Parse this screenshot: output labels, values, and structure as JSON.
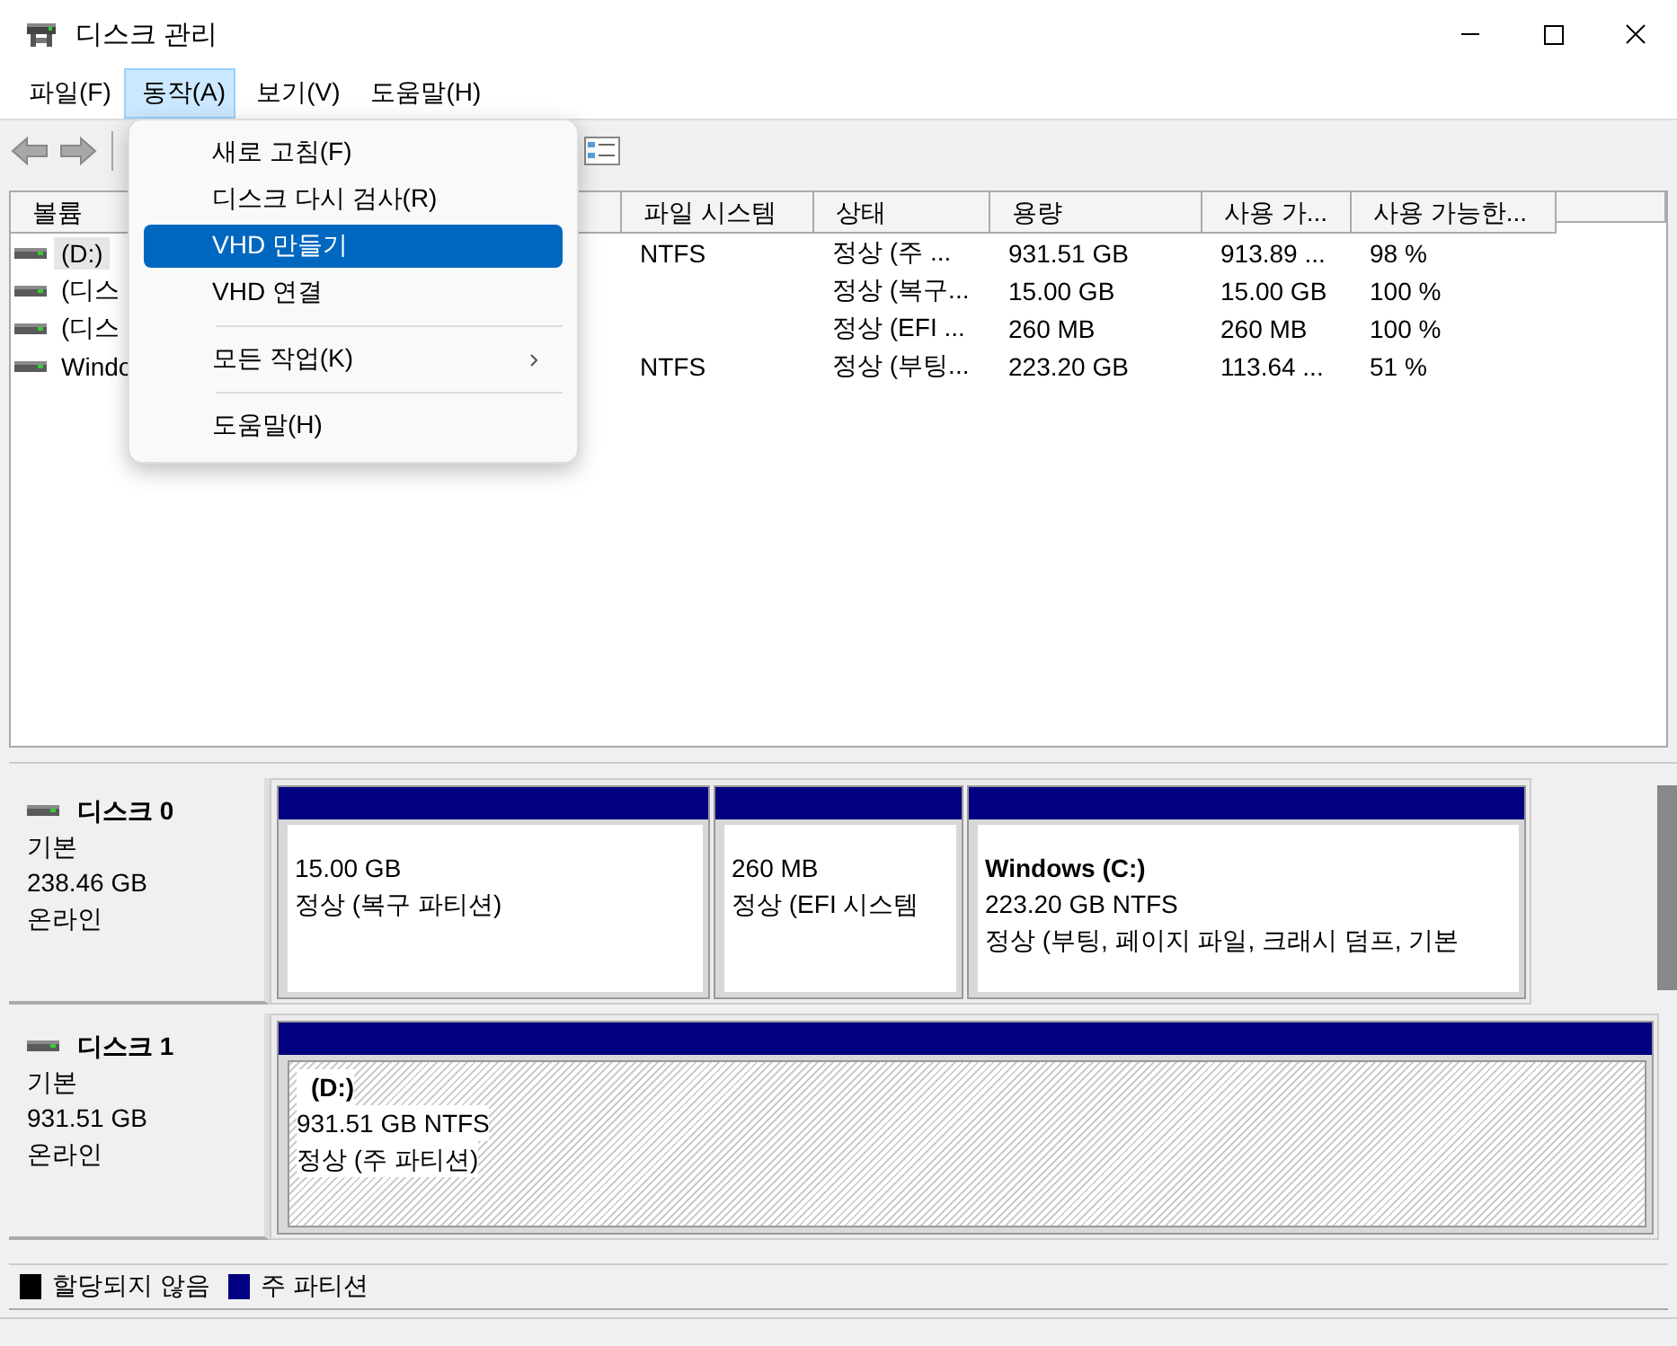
{
  "window": {
    "title": "디스크 관리"
  },
  "menubar": [
    {
      "label": "파일(F)",
      "selected": false
    },
    {
      "label": "동작(A)",
      "selected": true
    },
    {
      "label": "보기(V)",
      "selected": false
    },
    {
      "label": "도움말(H)",
      "selected": false
    }
  ],
  "action_menu": {
    "groups": [
      [
        {
          "label": "새로 고침(F)",
          "selected": false,
          "submenu": false
        },
        {
          "label": "디스크 다시 검사(R)",
          "selected": false,
          "submenu": false
        },
        {
          "label": "VHD 만들기",
          "selected": true,
          "submenu": false
        },
        {
          "label": "VHD 연결",
          "selected": false,
          "submenu": false
        }
      ],
      [
        {
          "label": "모든 작업(K)",
          "selected": false,
          "submenu": true
        }
      ],
      [
        {
          "label": "도움말(H)",
          "selected": false,
          "submenu": false
        }
      ]
    ]
  },
  "volume_table": {
    "columns": [
      "볼륨",
      "파일 시스템",
      "상태",
      "용량",
      "사용 가...",
      "사용 가능한..."
    ],
    "rows": [
      {
        "selected": true,
        "cells": [
          "(D:)",
          "NTFS",
          "정상 (주 ...",
          "931.51 GB",
          "913.89 ...",
          "98 %"
        ]
      },
      {
        "selected": false,
        "cells": [
          "(디스",
          "",
          "정상 (복구...",
          "15.00 GB",
          "15.00 GB",
          "100 %"
        ]
      },
      {
        "selected": false,
        "cells": [
          "(디스",
          "",
          "정상 (EFI ...",
          "260 MB",
          "260 MB",
          "100 %"
        ]
      },
      {
        "selected": false,
        "cells": [
          "Windo",
          "NTFS",
          "정상 (부팅...",
          "223.20 GB",
          "113.64 ...",
          "51 %"
        ]
      }
    ]
  },
  "disks": [
    {
      "name": "디스크 0",
      "type": "기본",
      "size": "238.46 GB",
      "status": "온라인",
      "partitions": [
        {
          "size": "15.00 GB",
          "status": "정상 (복구 파티션)",
          "selected": false
        },
        {
          "size": "260 MB",
          "status": "정상 (EFI 시스템",
          "selected": false
        },
        {
          "label": "Windows  (C:)",
          "size": "223.20 GB NTFS",
          "status": "정상 (부팅, 페이지 파일, 크래시 덤프, 기본",
          "selected": false
        }
      ]
    },
    {
      "name": "디스크 1",
      "type": "기본",
      "size": "931.51 GB",
      "status": "온라인",
      "partitions": [
        {
          "label": "(D:)",
          "size": "931.51 GB NTFS",
          "status": "정상 (주 파티션)",
          "selected": true
        }
      ]
    }
  ],
  "legend": [
    {
      "label": "할당되지 않음",
      "color": "#000000"
    },
    {
      "label": "주 파티션",
      "color": "#000080"
    }
  ]
}
